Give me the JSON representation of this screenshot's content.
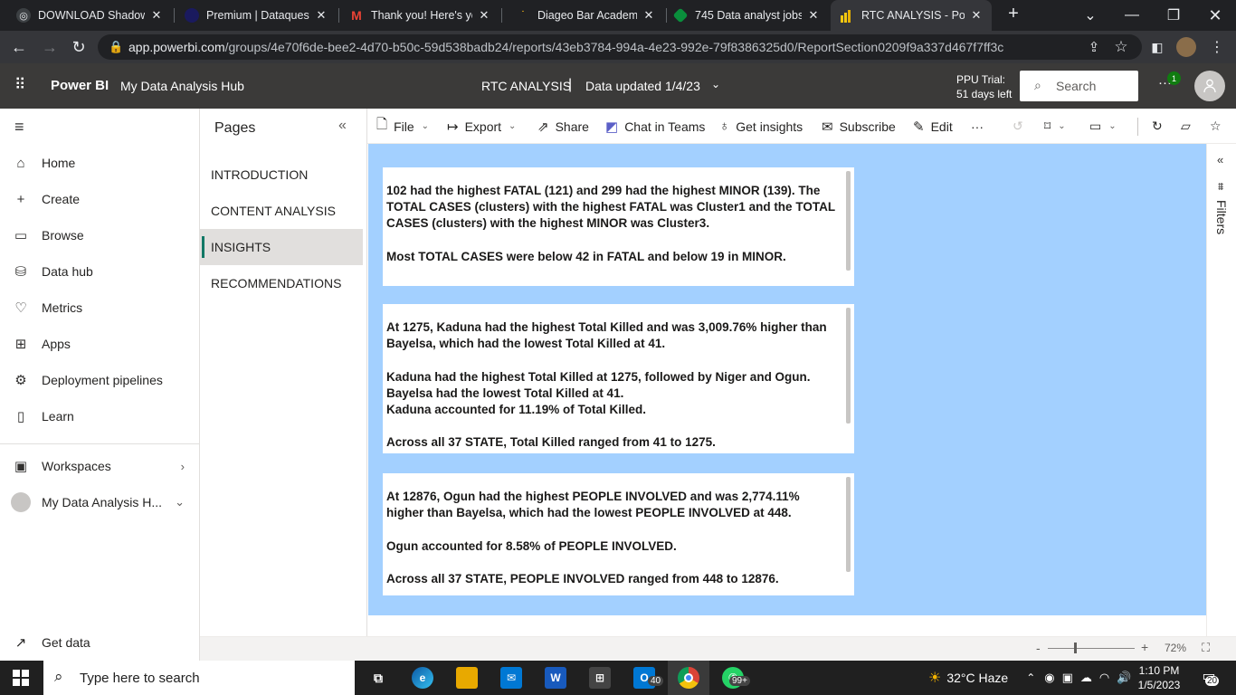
{
  "browser": {
    "tabs": [
      {
        "title": "DOWNLOAD Shadow",
        "icon": "shadow-icon",
        "color": "#3c4043"
      },
      {
        "title": "Premium | Dataquest",
        "icon": "dataquest-icon",
        "color": "#1a1a5e"
      },
      {
        "title": "Thank you! Here's you",
        "icon": "gmail-icon",
        "color": "#ea4335"
      },
      {
        "title": "Diageo Bar Academy",
        "icon": "diageo-icon",
        "color": "#d4a017"
      },
      {
        "title": "745 Data analyst jobs",
        "icon": "jobs-icon",
        "color": "#0a8f3c"
      },
      {
        "title": "RTC ANALYSIS - Power",
        "icon": "powerbi-icon",
        "color": "#f2c811"
      }
    ],
    "new_tab": "+",
    "url_host": "app.powerbi.com",
    "url_path": "/groups/4e70f6de-bee2-4d70-b50c-59d538badb24/reports/43eb3784-994a-4e23-992e-79f8386325d0/ReportSection0209f9a337d467f7ff3c"
  },
  "header": {
    "brand": "Power BI",
    "workspace": "My Data Analysis Hub",
    "report_name": "RTC ANALYSIS",
    "separator": "|",
    "data_updated": "Data updated 1/4/23",
    "trial_line1": "PPU Trial:",
    "trial_line2": "51 days left",
    "search_placeholder": "Search",
    "notification_count": "1"
  },
  "nav": {
    "items": [
      {
        "label": "Home",
        "icon": "home-icon",
        "glyph": "⌂"
      },
      {
        "label": "Create",
        "icon": "plus-icon",
        "glyph": "+"
      },
      {
        "label": "Browse",
        "icon": "folder-icon",
        "glyph": "▭"
      },
      {
        "label": "Data hub",
        "icon": "datahub-icon",
        "glyph": "⛁"
      },
      {
        "label": "Metrics",
        "icon": "metrics-icon",
        "glyph": "♡"
      },
      {
        "label": "Apps",
        "icon": "apps-icon",
        "glyph": "⊞"
      },
      {
        "label": "Deployment pipelines",
        "icon": "pipeline-icon",
        "glyph": "⚙"
      },
      {
        "label": "Learn",
        "icon": "book-icon",
        "glyph": "▯"
      }
    ],
    "workspaces": "Workspaces",
    "my_workspace": "My Data Analysis H...",
    "get_data": "Get data"
  },
  "pages": {
    "title": "Pages",
    "items": [
      "INTRODUCTION",
      "CONTENT ANALYSIS",
      "INSIGHTS",
      "RECOMMENDATIONS"
    ],
    "selected_index": 2
  },
  "actions": {
    "file": "File",
    "export": "Export",
    "share": "Share",
    "chat": "Chat in Teams",
    "insights": "Get insights",
    "subscribe": "Subscribe",
    "edit": "Edit",
    "more": "···"
  },
  "cards": [
    {
      "paragraphs": [
        "102 had the highest FATAL (121) and 299 had the highest MINOR (139). The TOTAL CASES (clusters) with the highest FATAL was Cluster1 and the TOTAL CASES (clusters) with the highest MINOR was Cluster3.",
        "Most TOTAL CASES were below 42 in FATAL and below 19 in MINOR."
      ]
    },
    {
      "paragraphs": [
        "At 1275, Kaduna had the highest Total Killed and was 3,009.76% higher than Bayelsa, which had the lowest Total Killed at 41.",
        "Kaduna had the highest Total Killed at 1275, followed by Niger and Ogun. Bayelsa had the lowest Total Killed at 41.\nKaduna accounted for 11.19% of Total Killed.",
        "Across all 37 STATE, Total Killed ranged from 41 to 1275."
      ]
    },
    {
      "paragraphs": [
        "At 12876, Ogun had the highest PEOPLE INVOLVED and was 2,774.11% higher than Bayelsa, which had the lowest PEOPLE INVOLVED at 448.",
        "Ogun accounted for 8.58% of PEOPLE INVOLVED.",
        "Across all 37 STATE, PEOPLE INVOLVED ranged from 448 to 12876."
      ]
    }
  ],
  "filters": {
    "label": "Filters"
  },
  "zoom": {
    "level": "72%"
  },
  "taskbar": {
    "search_placeholder": "Type here to search",
    "mail_badge": "40",
    "whatsapp_badge": "99+",
    "weather": "32°C  Haze",
    "time": "1:10 PM",
    "date": "1/5/2023",
    "notifications": "20"
  },
  "colors": {
    "canvas_bg": "#a3d0ff",
    "header_bg": "#3b3a39",
    "accent": "#117865"
  }
}
